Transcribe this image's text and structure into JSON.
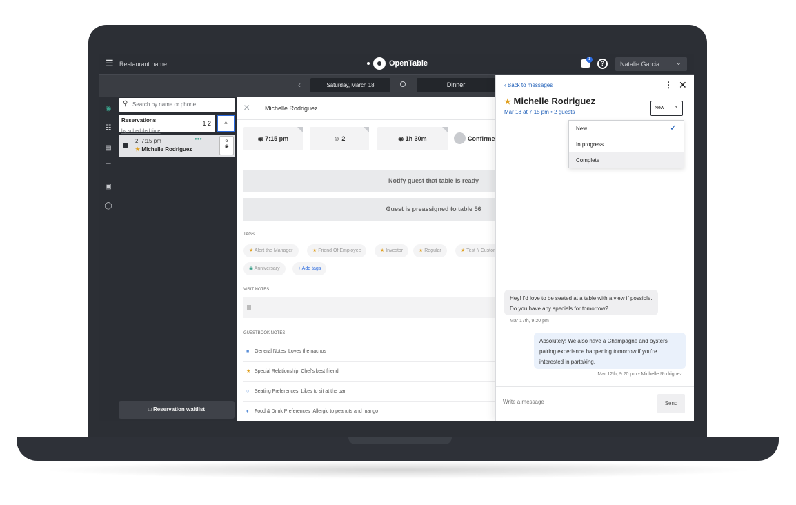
{
  "topbar": {
    "restaurant_name": "Restaurant name",
    "brand": "OpenTable",
    "message_badge": "1",
    "help_glyph": "?",
    "user_name": "Natalie Garcia"
  },
  "datebar": {
    "date": "Saturday, March 18",
    "shift": "Dinner"
  },
  "rail_icons": [
    "floor-plan-icon",
    "timeline-icon",
    "table-icon",
    "list-icon",
    "guestbook-icon",
    "shield-icon"
  ],
  "reservations": {
    "search_placeholder": "Search by name or phone",
    "title": "Reservations",
    "sort_label": "by scheduled time",
    "counts": "1  2",
    "items": [
      {
        "party": "2",
        "time": "7:15 pm",
        "name": "Michelle Rodriguez",
        "table": "6",
        "vip": true
      }
    ],
    "waitlist_label": "Reservation waitlist"
  },
  "detail": {
    "guest_name": "Michelle Rodriguez",
    "time": "7:15 pm",
    "party_size": "2",
    "duration": "1h 30m",
    "status": "Confirmed",
    "notify_label": "Notify guest that table is ready",
    "preassigned_label": "Guest is preassigned to table 56",
    "tags_label": "Tags",
    "tags": [
      "Alert the Manager",
      "Friend Of Employee",
      "Investor",
      "Regular",
      "Test // Custom"
    ],
    "tags_row2": [
      "Anniversary"
    ],
    "add_tags_label": "+ Add tags",
    "visit_notes_label": "Visit notes",
    "guestbook_label": "Guestbook notes",
    "guestbook_notes": [
      {
        "category": "General Notes",
        "value": "Loves the nachos"
      },
      {
        "category": "Special Relationship",
        "value": "Chef's best friend"
      },
      {
        "category": "Seating Preferences",
        "value": "Likes to sit at the bar"
      },
      {
        "category": "Food & Drink Preferences",
        "value": "Allergic to peanuts and mango"
      }
    ]
  },
  "panel": {
    "back_label": "Back to messages",
    "guest_name": "Michelle Rodriguez",
    "meta": "Mar 18 at 7:15 pm  •  2 guests",
    "status_value": "New",
    "status_options": [
      "New",
      "In progress",
      "Complete"
    ],
    "messages": [
      {
        "direction": "in",
        "text": "Hey! I'd love to be seated at a table with a view if possible. Do you have any specials for tomorrow?",
        "time": "Mar 17th, 9:20 pm"
      },
      {
        "direction": "out",
        "text": "Absolutely! We also have a Champagne and oysters pairing experience happening tomorrow if you're interested in partaking.",
        "time": "Mar 12th, 9:20 pm • Michelle Rodriguez"
      }
    ],
    "composer_placeholder": "Write a message",
    "send_label": "Send"
  }
}
